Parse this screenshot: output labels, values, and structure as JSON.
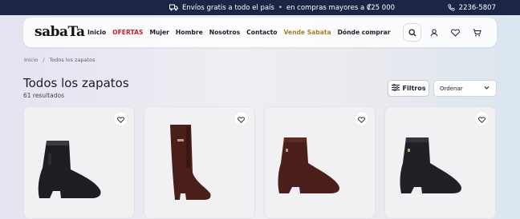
{
  "promo": {
    "shipping_icon": "truck-icon",
    "shipping_text": "Envíos gratis a todo el país",
    "separator": "•",
    "shipping_condition": "en compras mayores a ₡25 000",
    "phone_icon": "phone-icon",
    "phone": "2236-5807"
  },
  "header": {
    "logo": "sabaTa",
    "nav": [
      {
        "label": "Inicio",
        "color": "#1a1c2b"
      },
      {
        "label": "OFERTAS",
        "color": "#c5222c"
      },
      {
        "label": "Mujer",
        "color": "#1a1c2b"
      },
      {
        "label": "Hombre",
        "color": "#1a1c2b"
      },
      {
        "label": "Nosotros",
        "color": "#1a1c2b"
      },
      {
        "label": "Contacto",
        "color": "#1a1c2b"
      },
      {
        "label": "Vende Sabata",
        "color": "#a57f2a"
      },
      {
        "label": "Dónde comprar",
        "color": "#1a1c2b"
      }
    ],
    "icons": [
      "search-icon",
      "user-icon",
      "heart-icon",
      "cart-icon"
    ]
  },
  "breadcrumb": {
    "home": "Inicio",
    "separator": "/",
    "current": "Todos los zapatos"
  },
  "page": {
    "title": "Todos los zapatos",
    "results": "61 resultados",
    "filters_label": "Filtros",
    "sort_label": "Ordenar"
  },
  "products": [
    {
      "style": "ankle-boot",
      "color": "#1e1e22"
    },
    {
      "style": "tall-boot",
      "color": "#4a1f1a"
    },
    {
      "style": "ankle-boot",
      "color": "#4b1f1b"
    },
    {
      "style": "ankle-boot",
      "color": "#202026"
    }
  ],
  "colors": {
    "promo_bg": "#1c2545",
    "accent_red": "#c5222c",
    "accent_gold": "#a57f2a"
  }
}
